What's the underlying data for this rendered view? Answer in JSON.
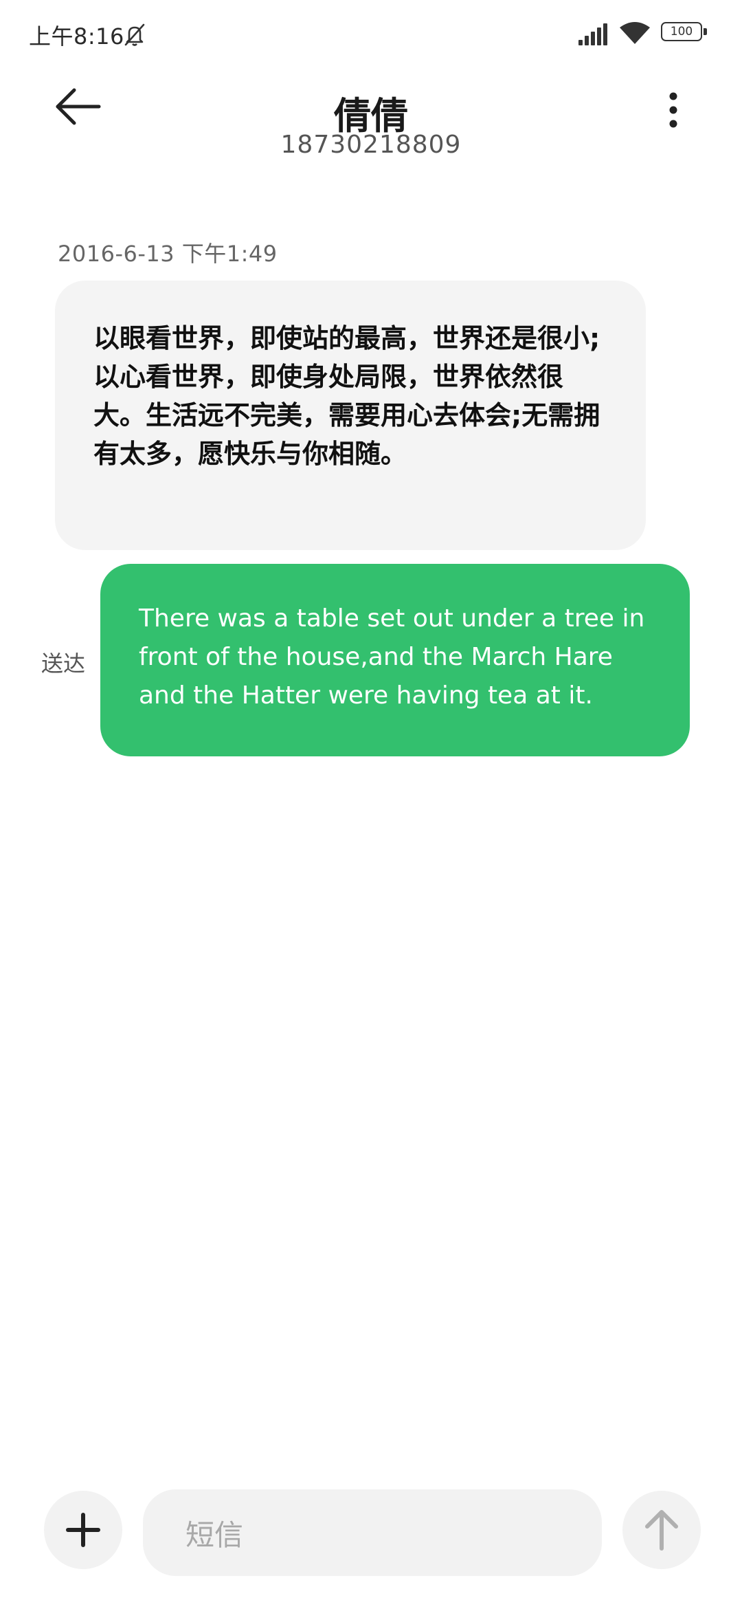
{
  "status_bar": {
    "time": "上午8:16",
    "battery": "100",
    "icons": [
      "mute-icon",
      "signal-icon",
      "wifi-icon",
      "battery-icon"
    ]
  },
  "header": {
    "contact_name": "倩倩",
    "contact_number": "18730218809",
    "icons": [
      "back-arrow-icon",
      "more-vertical-icon"
    ]
  },
  "conversation": {
    "timestamp": "2016-6-13 下午1:49",
    "messages": [
      {
        "direction": "received",
        "text": "以眼看世界，即使站的最高，世界还是很小;以心看世界，即使身处局限，世界依然很大。生活远不完美，需要用心去体会;无需拥有太多，愿快乐与你相随。"
      },
      {
        "direction": "sent",
        "status": "送达",
        "text": "There was a table set out under a tree in front of the house,and the March Hare and the Hatter were having tea at it."
      }
    ]
  },
  "composer": {
    "placeholder": "短信",
    "icons": [
      "plus-icon",
      "send-arrow-icon"
    ]
  },
  "colors": {
    "sent_bubble": "#33c06e",
    "received_bubble": "#f4f4f4",
    "composer_background": "#f2f2f2"
  }
}
